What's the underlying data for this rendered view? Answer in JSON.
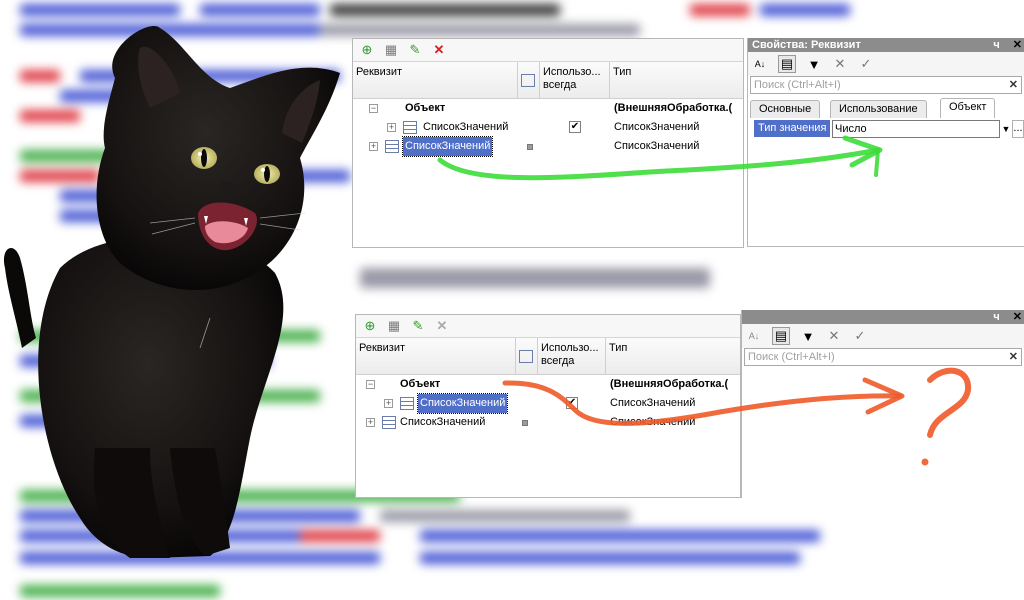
{
  "colors": {
    "selection": "#4f6fc8",
    "arrow_good": "#3ddc3a",
    "arrow_bad": "#f05a28",
    "delete": "#d42020",
    "edit": "#3a9a2a"
  },
  "icons": [
    "add-icon",
    "copy-icon",
    "edit-icon",
    "delete-icon",
    "sort-icon",
    "categories-icon",
    "filter-icon",
    "cancel-icon",
    "check-icon",
    "table-icon",
    "expand-icon",
    "collapse-icon",
    "checkbox-icon",
    "dropdown-icon",
    "ellipsis-icon",
    "pin-icon",
    "close-icon"
  ],
  "top_panel": {
    "headers": {
      "attribute": "Реквизит",
      "always_used": "Использо... всегда",
      "type": "Тип"
    },
    "rows": [
      {
        "name": "Объект",
        "type": "(ВнешняяОбработка.(",
        "expander": "−"
      },
      {
        "name": "СписокЗначений",
        "type": "СписокЗначений",
        "checked": "✔"
      },
      {
        "name": "СписокЗначений",
        "type": "СписокЗначений",
        "expander": "+"
      }
    ]
  },
  "top_props": {
    "title": "Свойства: Реквизит",
    "pin": "ч",
    "close": "✕",
    "search_placeholder": "Поиск (Ctrl+Alt+I)",
    "tabs": [
      "Основные",
      "Использование",
      "Объект"
    ],
    "property_label": "Тип значения",
    "property_value": "Число",
    "more": "..."
  },
  "bottom_panel": {
    "headers": {
      "attribute": "Реквизит",
      "always_used": "Использо... всегда",
      "type": "Тип"
    },
    "rows": [
      {
        "name": "Объект",
        "type": "(ВнешняяОбработка.(",
        "expander": "−"
      },
      {
        "name": "СписокЗначений",
        "type": "СписокЗначений",
        "checked": "✔"
      },
      {
        "name": "СписокЗначений",
        "type": "СписокЗначений",
        "expander": "+"
      }
    ]
  },
  "bottom_props": {
    "pin": "ч",
    "close": "✕",
    "search_placeholder": "Поиск (Ctrl+Alt+I)"
  }
}
